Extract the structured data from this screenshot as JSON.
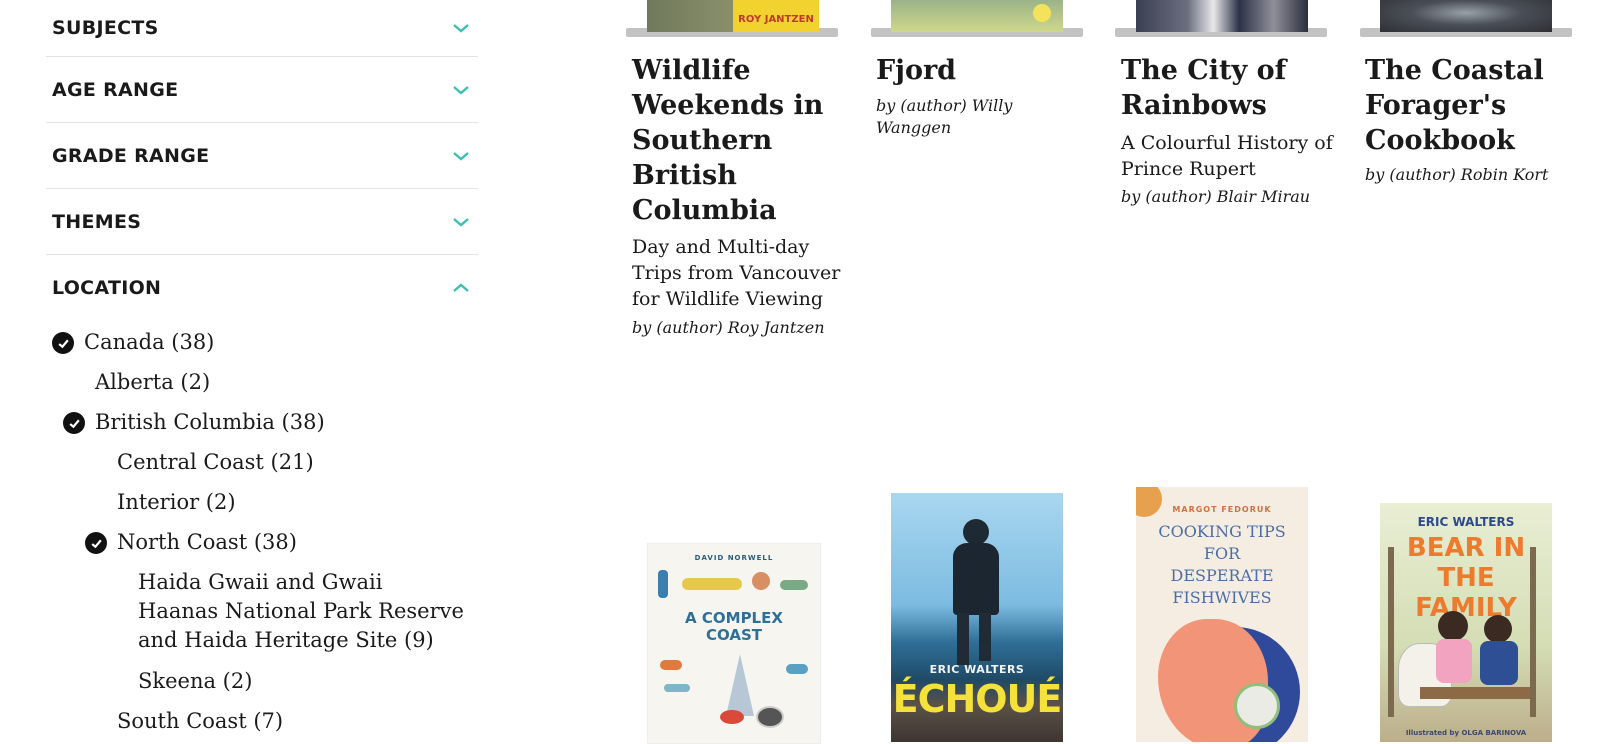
{
  "facets": [
    {
      "label": "SUBJECTS",
      "state": "collapsed"
    },
    {
      "label": "AGE RANGE",
      "state": "collapsed"
    },
    {
      "label": "GRADE RANGE",
      "state": "collapsed"
    },
    {
      "label": "THEMES",
      "state": "collapsed"
    },
    {
      "label": "LOCATION",
      "state": "expanded"
    }
  ],
  "location_items": [
    {
      "label": "Canada (38)",
      "checked": true
    },
    {
      "label": "Alberta (2)",
      "checked": false
    },
    {
      "label": "British Columbia (38)",
      "checked": true
    },
    {
      "label": "Central Coast (21)",
      "checked": false
    },
    {
      "label": "Interior (2)",
      "checked": false
    },
    {
      "label": "North Coast (38)",
      "checked": true
    },
    {
      "label": "Haida Gwaii and Gwaii Haanas National Park Reserve and Haida Heritage Site (9)",
      "checked": false
    },
    {
      "label": "Skeena (2)",
      "checked": false
    },
    {
      "label": "South Coast (7)",
      "checked": false
    }
  ],
  "books_row1": [
    {
      "title": "Wildlife Weekends in Southern British Columbia",
      "subtitle": "Day and Multi-day Trips from Vancouver for Wildlife Viewing",
      "author": "by (author) Roy Jantzen",
      "cover_text": "ROY JANTZEN"
    },
    {
      "title": "Fjord",
      "subtitle": "",
      "author": "by (author) Willy Wanggen"
    },
    {
      "title": "The City of Rainbows",
      "subtitle": "A Colourful History of Prince Rupert",
      "author": "by (author) Blair Mirau"
    },
    {
      "title": "The Coastal Forager's Cookbook",
      "subtitle": "",
      "author": "by (author) Robin Kort"
    }
  ],
  "books_row2": [
    {
      "cover_author": "DAVID NORWELL",
      "cover_title": "A COMPLEX COAST"
    },
    {
      "cover_author": "ERIC WALTERS",
      "cover_title": "ÉCHOUÉ"
    },
    {
      "cover_author": "MARGOT FEDORUK",
      "cover_title": "COOKING TIPS FOR DESPERATE FISHWIVES"
    },
    {
      "cover_author": "ERIC WALTERS",
      "cover_title": "BEAR IN THE FAMILY",
      "cover_credit": "Illustrated by OLGA BARINOVA"
    }
  ],
  "colors": {
    "accent": "#3fbfb0",
    "text": "#1a1a1a",
    "divider": "#e3e3e3"
  }
}
